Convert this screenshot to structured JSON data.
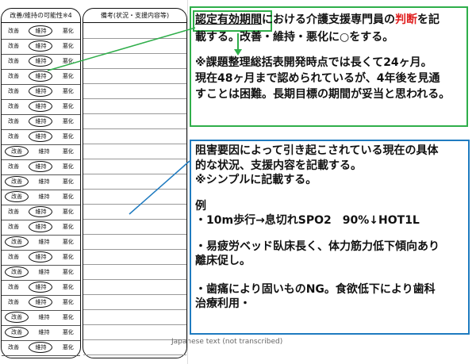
{
  "left_sheet": {
    "col1_header": "改善/維持の可能性※4",
    "col2_header": "備考(状況・支援内容等)",
    "row_labels": [
      "改善",
      "維持",
      "悪化"
    ],
    "row_circles": [
      "維持",
      "維持",
      "維持",
      "維持",
      "維持",
      "維持",
      "維持",
      "維持",
      "改善",
      "維持",
      "改善",
      "改善",
      "維持",
      "維持",
      "改善",
      "維持",
      "改善",
      "維持",
      "維持",
      "改善",
      "改善",
      "維持"
    ]
  },
  "footer": {
    "credit": "Japanese text (not transcribed)"
  },
  "green_box": {
    "line1_part1": "認定有効期間",
    "line1_part2": "における介護支援専門員の",
    "line1_red": "判断",
    "line1_part3": "を記",
    "line2": "載する。改善・維持・悪化に○をする。",
    "line3": "※課題整理総括表開発時点では長くて24ヶ月。",
    "line4": "現在48ヶ月まで認められているが、4年後を見通",
    "line5": "すことは困難。長期目標の期間が妥当と思われる。"
  },
  "blue_box": {
    "line1": "阻害要因によって引き起こされている現在の具体",
    "line2": "的な状況、支援内容を記載する。",
    "line3": "※シンプルに記載する。",
    "example_label": "例",
    "ex1": "・10m歩行→息切れSPO2　90%↓HOT1L",
    "ex2a": "・易疲労ベッド臥床長く、体力筋力低下傾向あり",
    "ex2b": "離床促し。",
    "ex3a": "・歯痛により固いものNG。食欲低下により歯科",
    "ex3b": "治療利用・"
  },
  "colors": {
    "green": "#2fae4a",
    "blue": "#1f7bc0",
    "red": "#e02020"
  }
}
